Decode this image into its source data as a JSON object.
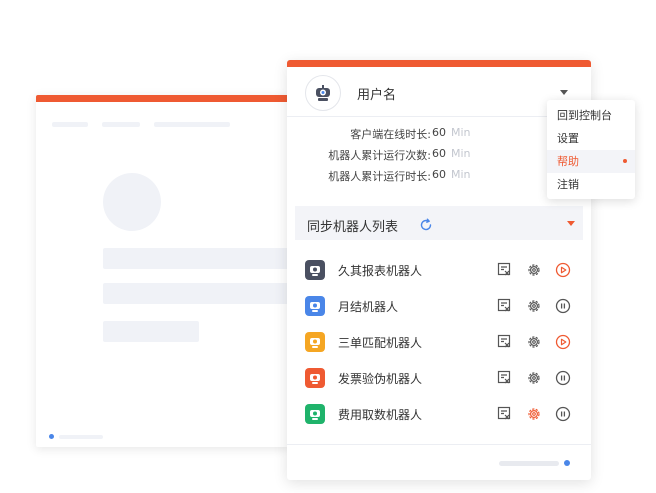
{
  "header": {
    "username": "用户名"
  },
  "stats": [
    {
      "label": "客户端在线时长:",
      "value": "60",
      "unit": "Min"
    },
    {
      "label": "机器人累计运行次数:",
      "value": "60",
      "unit": "Min"
    },
    {
      "label": "机器人累计运行时长:",
      "value": "60",
      "unit": "Min"
    }
  ],
  "section": {
    "title": "同步机器人列表"
  },
  "robots": [
    {
      "name": "久其报表机器人",
      "icon_color": "#4a5061",
      "settings_active": false,
      "action": "play-icon"
    },
    {
      "name": "月结机器人",
      "icon_color": "#4a86e8",
      "settings_active": false,
      "action": "pause-icon"
    },
    {
      "name": "三单匹配机器人",
      "icon_color": "#f5a623",
      "settings_active": false,
      "action": "play-icon"
    },
    {
      "name": "发票验伪机器人",
      "icon_color": "#ef5a32",
      "settings_active": false,
      "action": "pause-icon"
    },
    {
      "name": "费用取数机器人",
      "icon_color": "#1fb36b",
      "settings_active": true,
      "action": "pause-icon"
    }
  ],
  "menu": {
    "items": [
      {
        "label": "回到控制台"
      },
      {
        "label": "设置"
      },
      {
        "label": "帮助"
      },
      {
        "label": "注销"
      }
    ],
    "active_index": 2
  },
  "colors": {
    "accent": "#ef5a32",
    "blue": "#4a86e8"
  }
}
